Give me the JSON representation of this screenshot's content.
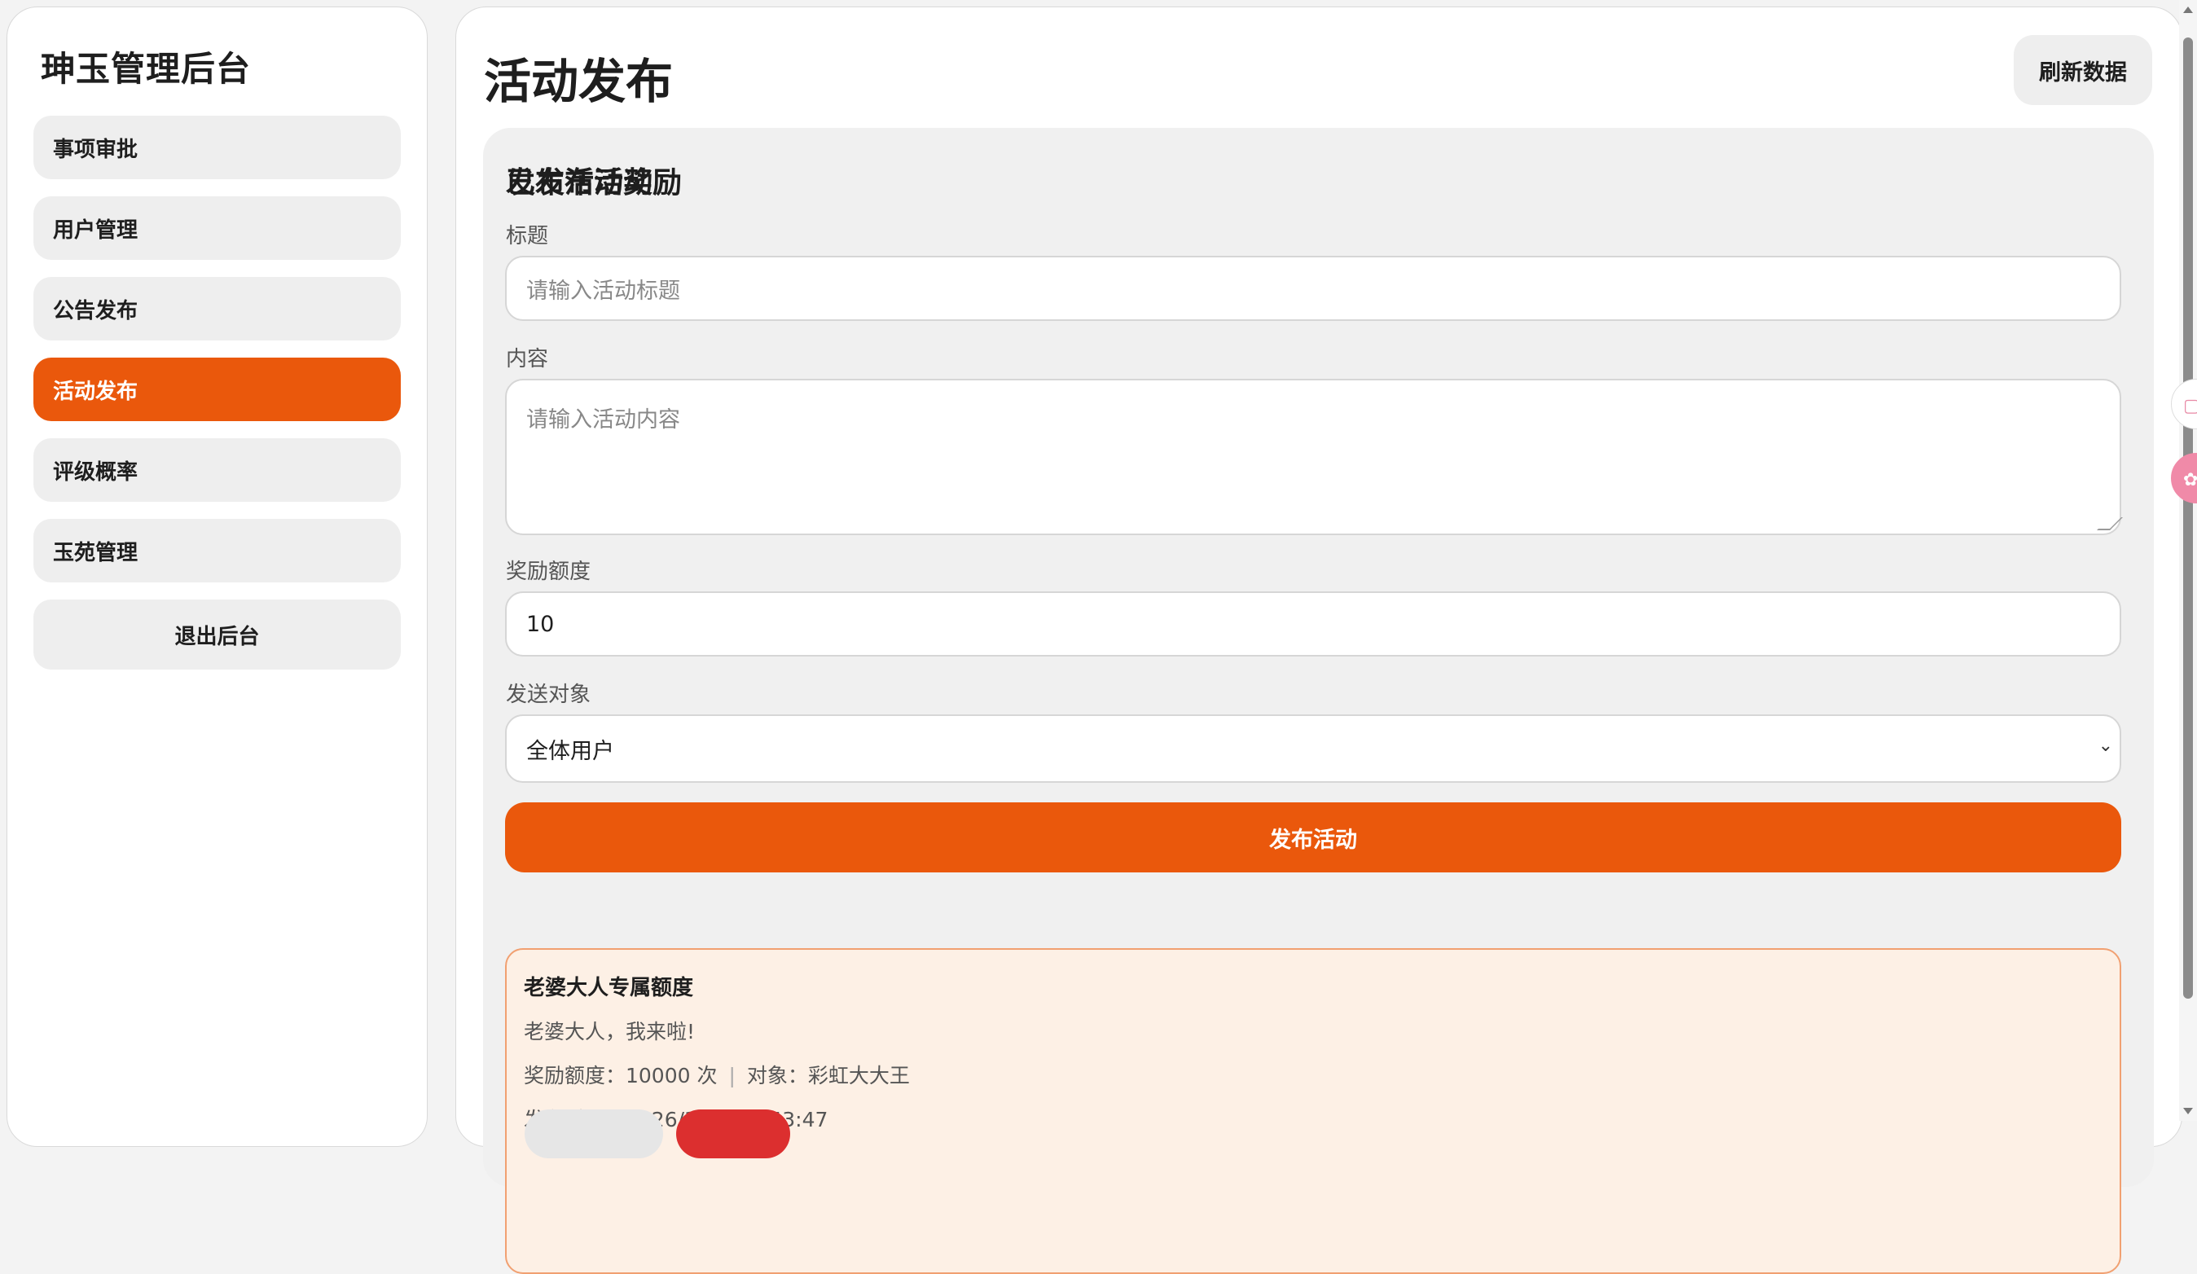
{
  "sidebar": {
    "brand": "珅玉管理后台",
    "items": [
      {
        "label": "事项审批"
      },
      {
        "label": "用户管理"
      },
      {
        "label": "公告发布"
      },
      {
        "label": "活动发布"
      },
      {
        "label": "评级概率"
      },
      {
        "label": "玉苑管理"
      }
    ],
    "active_index": 3,
    "logout_label": "退出后台"
  },
  "header": {
    "title": "活动发布",
    "refresh_label": "刷新数据"
  },
  "form": {
    "heading": "发布活动奖励",
    "title_label": "标题",
    "title_placeholder": "请输入活动标题",
    "content_label": "内容",
    "content_placeholder": "请输入活动内容",
    "reward_label": "奖励额度",
    "reward_value": "10",
    "target_label": "发送对象",
    "target_value": "全体用户",
    "submit_label": "发布活动"
  },
  "published": {
    "heading": "已发布活动",
    "items": [
      {
        "title": "老婆大人专属额度",
        "content": "老婆大人，我来啦!",
        "reward_text": "奖励额度：10000 次",
        "target_text": "对象：彩虹大大王",
        "time_text": "发布时间：2026/3/26 22:43:47"
      }
    ]
  },
  "colors": {
    "accent": "#ea580c",
    "activity_bg": "#fdf0e5",
    "activity_border": "#f1a071",
    "danger": "#dc2f2f"
  }
}
